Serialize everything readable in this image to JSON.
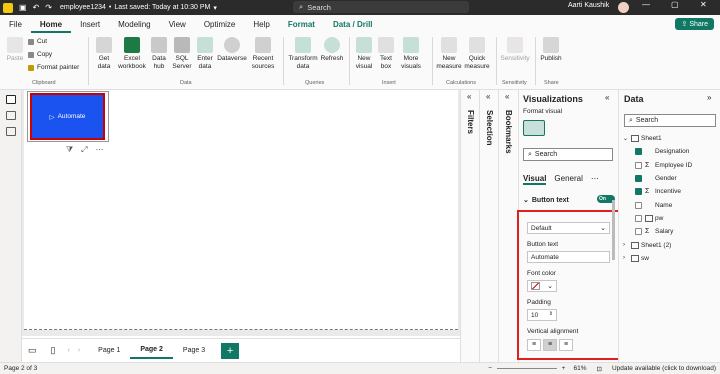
{
  "titlebar": {
    "file_name": "employee1234",
    "save_status": "Last saved: Today at 10:30 PM",
    "search_placeholder": "Search",
    "user_name": "Aarti Kaushik",
    "brand_color": "#117865"
  },
  "menu": {
    "items": [
      "File",
      "Home",
      "Insert",
      "Modeling",
      "View",
      "Optimize",
      "Help",
      "Format",
      "Data / Drill"
    ],
    "active": "Home",
    "share_label": "Share"
  },
  "ribbon": {
    "clipboard": {
      "paste": "Paste",
      "cut": "Cut",
      "copy": "Copy",
      "format_painter": "Format painter",
      "group": "Clipboard"
    },
    "data": {
      "get_data": "Get data",
      "excel": "Excel workbook",
      "data_hub": "Data hub",
      "sql": "SQL Server",
      "enter_data": "Enter data",
      "dataverse": "Dataverse",
      "recent": "Recent sources",
      "group": "Data"
    },
    "queries": {
      "transform": "Transform data",
      "refresh": "Refresh",
      "group": "Queries"
    },
    "insert": {
      "new_visual": "New visual",
      "text_box": "Text box",
      "more_visuals": "More visuals",
      "group": "Insert"
    },
    "calculations": {
      "new_measure": "New measure",
      "quick_measure": "Quick measure",
      "group": "Calculations"
    },
    "sensitivity": {
      "label": "Sensitivity",
      "group": "Sensitivity"
    },
    "share": {
      "publish": "Publish",
      "group": "Share"
    }
  },
  "canvas": {
    "button_text": "Automate",
    "button_icon": "play-icon",
    "button_color": "#1a53f0"
  },
  "pages": {
    "tabs": [
      "Page 1",
      "Page 2",
      "Page 3"
    ],
    "active": "Page 2",
    "add_label": "+"
  },
  "side_panels": {
    "filters": "Filters",
    "selection": "Selection",
    "bookmarks": "Bookmarks"
  },
  "visualizations": {
    "title": "Visualizations",
    "format_visual": "Format visual",
    "search_placeholder": "Search",
    "tabs": [
      "Visual",
      "General"
    ],
    "active_tab": "Visual",
    "section": "Button text",
    "toggle": "On",
    "state_dropdown": "Default",
    "button_text_label": "Button text",
    "button_text_value": "Automate",
    "font_color_label": "Font color",
    "padding_label": "Padding",
    "padding_value": "10",
    "vertical_alignment_label": "Vertical alignment"
  },
  "data_pane": {
    "title": "Data",
    "search_placeholder": "Search",
    "tree": [
      {
        "label": "Sheet1",
        "type": "table",
        "expanded": true
      },
      {
        "label": "Designation",
        "type": "field",
        "checked": true
      },
      {
        "label": "Employee ID",
        "type": "measure",
        "checked": false
      },
      {
        "label": "Gender",
        "type": "field",
        "checked": true
      },
      {
        "label": "Incentive",
        "type": "measure",
        "checked": true
      },
      {
        "label": "Name",
        "type": "field",
        "checked": false
      },
      {
        "label": "pw",
        "type": "table-field",
        "checked": false
      },
      {
        "label": "Salary",
        "type": "measure",
        "checked": false
      },
      {
        "label": "Sheet1 (2)",
        "type": "table",
        "expanded": false
      },
      {
        "label": "sw",
        "type": "table",
        "expanded": false
      }
    ]
  },
  "status": {
    "page_indicator": "Page 2 of 3",
    "zoom": "61%",
    "update_notice": "Update available (click to download)"
  }
}
